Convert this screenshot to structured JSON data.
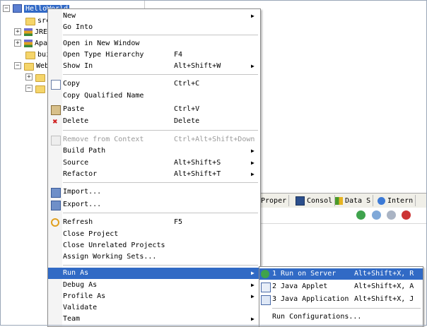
{
  "tree": {
    "items": [
      {
        "label": "HelloWorld"
      },
      {
        "label": "src"
      },
      {
        "label": "JRE"
      },
      {
        "label": "Apa"
      },
      {
        "label": "bui"
      },
      {
        "label": "Web"
      }
    ]
  },
  "views": {
    "tabs": [
      {
        "label": "Proper"
      },
      {
        "label": "Consol"
      },
      {
        "label": "Data S"
      },
      {
        "label": "Intern"
      }
    ]
  },
  "context_menu": {
    "new": "New",
    "go_into": "Go Into",
    "open_new_window": "Open in New Window",
    "open_type_hierarchy": "Open Type Hierarchy",
    "open_type_hierarchy_acc": "F4",
    "show_in": "Show In",
    "show_in_acc": "Alt+Shift+W",
    "copy": "Copy",
    "copy_acc": "Ctrl+C",
    "copy_qualified": "Copy Qualified Name",
    "paste": "Paste",
    "paste_acc": "Ctrl+V",
    "delete": "Delete",
    "delete_acc": "Delete",
    "remove_context": "Remove from Context",
    "remove_context_acc": "Ctrl+Alt+Shift+Down",
    "build_path": "Build Path",
    "source": "Source",
    "source_acc": "Alt+Shift+S",
    "refactor": "Refactor",
    "refactor_acc": "Alt+Shift+T",
    "import": "Import...",
    "export": "Export...",
    "refresh": "Refresh",
    "refresh_acc": "F5",
    "close_project": "Close Project",
    "close_unrelated": "Close Unrelated Projects",
    "assign_working_sets": "Assign Working Sets...",
    "run_as": "Run As",
    "debug_as": "Debug As",
    "profile_as": "Profile As",
    "validate": "Validate",
    "team": "Team"
  },
  "run_as_submenu": {
    "items": [
      {
        "label": "1 Run on Server",
        "accel": "Alt+Shift+X, R"
      },
      {
        "label": "2 Java Applet",
        "accel": "Alt+Shift+X, A"
      },
      {
        "label": "3 Java Application",
        "accel": "Alt+Shift+X, J"
      }
    ],
    "run_configurations": "Run Configurations..."
  },
  "colors": {
    "highlight": "#316ac5",
    "disabled": "#9a9a9a"
  }
}
